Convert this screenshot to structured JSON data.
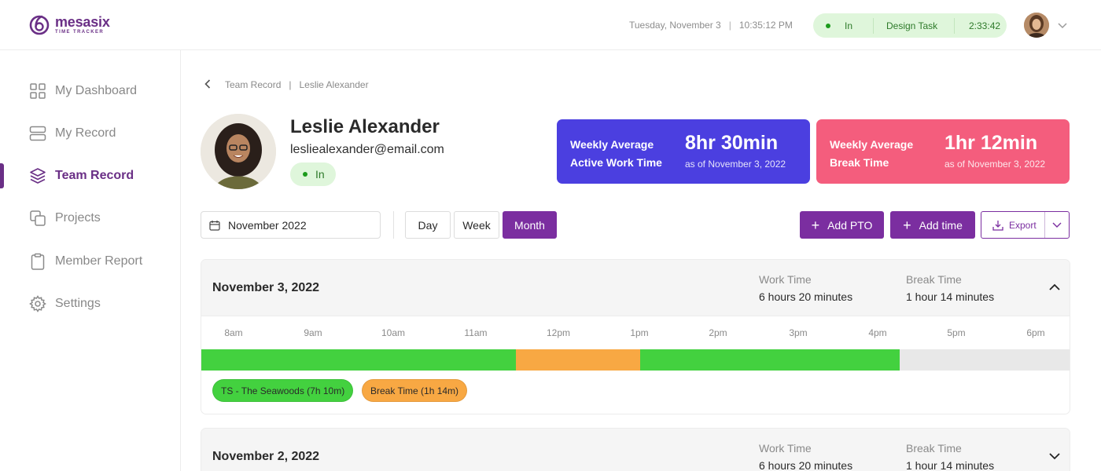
{
  "brand": {
    "name": "mesasix",
    "sub": "TIME TRACKER",
    "color": "#6a2f86"
  },
  "header": {
    "date": "Tuesday, November 3",
    "time": "10:35:12 PM",
    "status": "In",
    "task": "Design Task",
    "timer": "2:33:42"
  },
  "sidebar": {
    "items": [
      {
        "label": "My Dashboard",
        "icon": "grid-icon"
      },
      {
        "label": "My Record",
        "icon": "server-icon"
      },
      {
        "label": "Team Record",
        "icon": "layers-icon",
        "active": true
      },
      {
        "label": "Projects",
        "icon": "copy-icon"
      },
      {
        "label": "Member Report",
        "icon": "clipboard-icon"
      },
      {
        "label": "Settings",
        "icon": "gear-icon"
      }
    ]
  },
  "breadcrumb": {
    "parent": "Team Record",
    "current": "Leslie Alexander"
  },
  "profile": {
    "name": "Leslie Alexander",
    "email": "lesliealexander@email.com",
    "status": "In"
  },
  "stats": {
    "active": {
      "label1": "Weekly Average",
      "label2": "Active Work Time",
      "value": "8hr 30min",
      "asof": "as of November 3, 2022",
      "color": "#4b3fe0"
    },
    "break": {
      "label1": "Weekly Average",
      "label2": "Break Time",
      "value": "1hr 12min",
      "asof": "as of November 3, 2022",
      "color": "#f45d7d"
    }
  },
  "controls": {
    "date": "November 2022",
    "views": [
      "Day",
      "Week",
      "Month"
    ],
    "active_view": "Month",
    "add_pto": "Add PTO",
    "add_time": "Add time",
    "export": "Export"
  },
  "days": [
    {
      "title": "November 3, 2022",
      "work_label": "Work Time",
      "work_value": "6 hours 20 minutes",
      "break_label": "Break Time",
      "break_value": "1 hour 14 minutes",
      "expanded": true,
      "hours": [
        "8am",
        "9am",
        "10am",
        "11am",
        "12pm",
        "1pm",
        "2pm",
        "3pm",
        "4pm",
        "5pm",
        "6pm"
      ],
      "chips": [
        {
          "label": "TS - The Seawoods (7h 10m)",
          "color": "#43d13f"
        },
        {
          "label": "Break Time (1h 14m)",
          "color": "#f8a843"
        }
      ]
    },
    {
      "title": "November 2, 2022",
      "work_label": "Work Time",
      "work_value": "6 hours 20 minutes",
      "break_label": "Break Time",
      "break_value": "1 hour 14 minutes",
      "expanded": false
    }
  ],
  "colors": {
    "accent": "#7b2ea0",
    "work": "#43d13f",
    "break": "#f8a843",
    "status_bg": "#dff6db"
  }
}
